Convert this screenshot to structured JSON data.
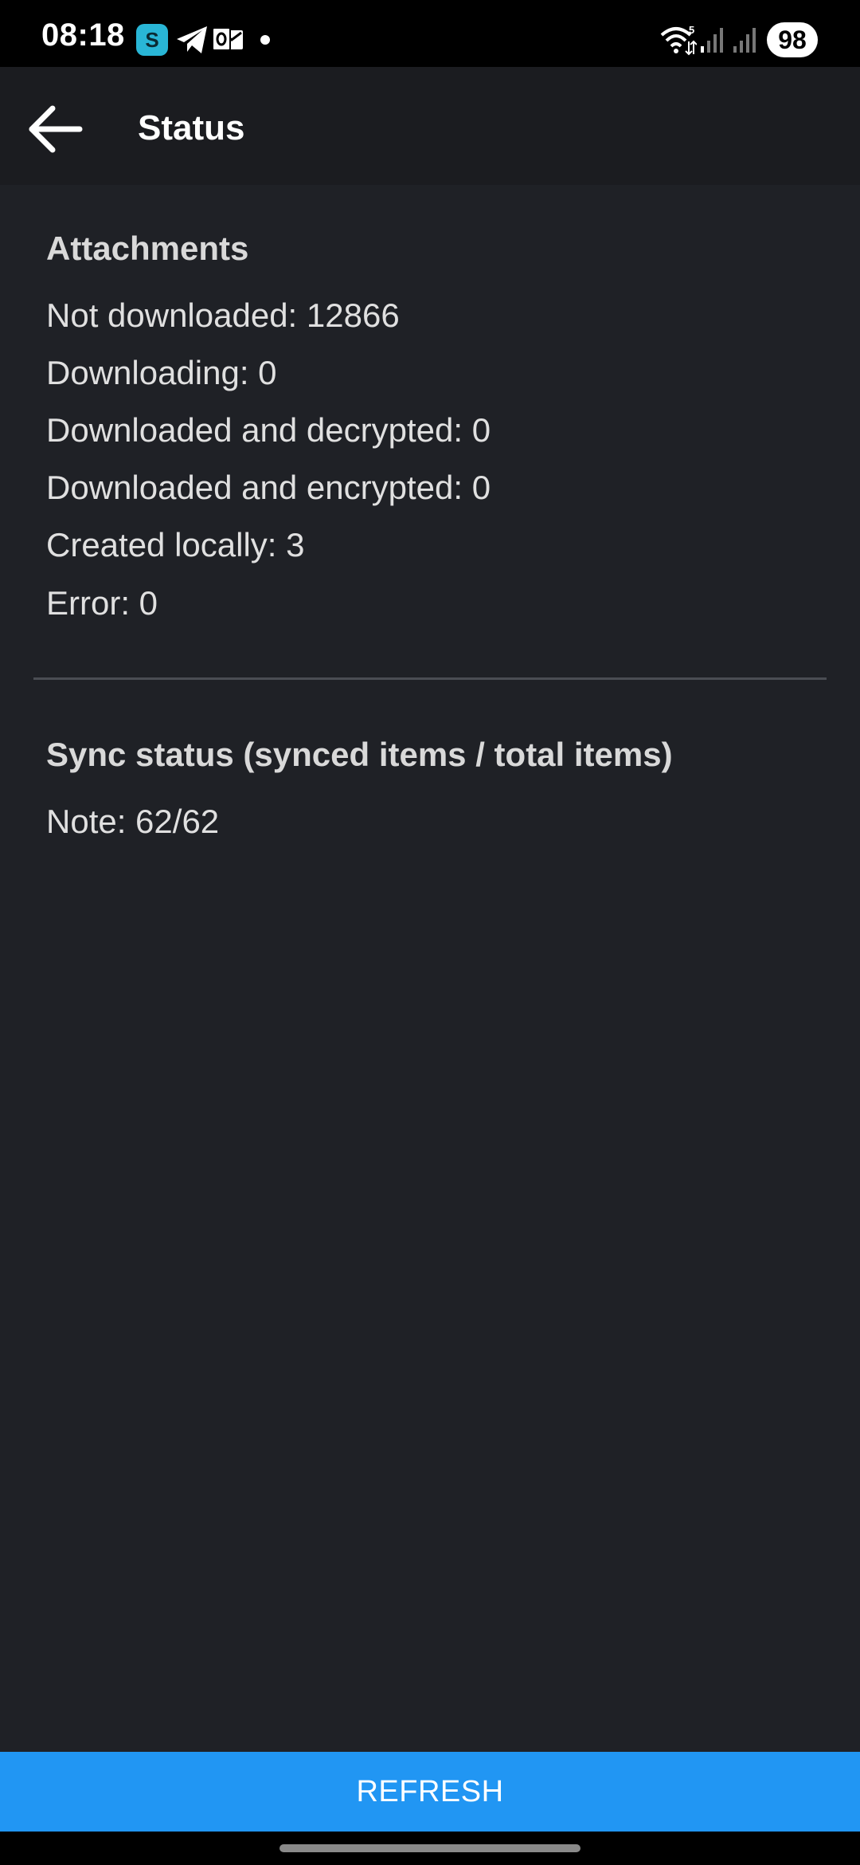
{
  "status_bar": {
    "time": "08:18",
    "battery": "98",
    "app_icon_letter": "S",
    "icons": [
      "app-icon",
      "telegram-icon",
      "outlook-icon",
      "notification-dot",
      "wifi-icon",
      "signal-icon",
      "signal-icon"
    ],
    "wifi_label": "5"
  },
  "appbar": {
    "title": "Status",
    "back_icon": "arrow-left-icon"
  },
  "attachments": {
    "title": "Attachments",
    "lines": [
      "Not downloaded: 12866",
      "Downloading: 0",
      "Downloaded and decrypted: 0",
      "Downloaded and encrypted: 0",
      "Created locally: 3",
      "Error: 0"
    ]
  },
  "sync": {
    "title": "Sync status (synced items / total items)",
    "lines": [
      "Note: 62/62"
    ]
  },
  "refresh_button": {
    "label": "REFRESH"
  },
  "colors": {
    "background": "#1f2126",
    "appbar": "#1b1c20",
    "accent": "#2196f3"
  }
}
